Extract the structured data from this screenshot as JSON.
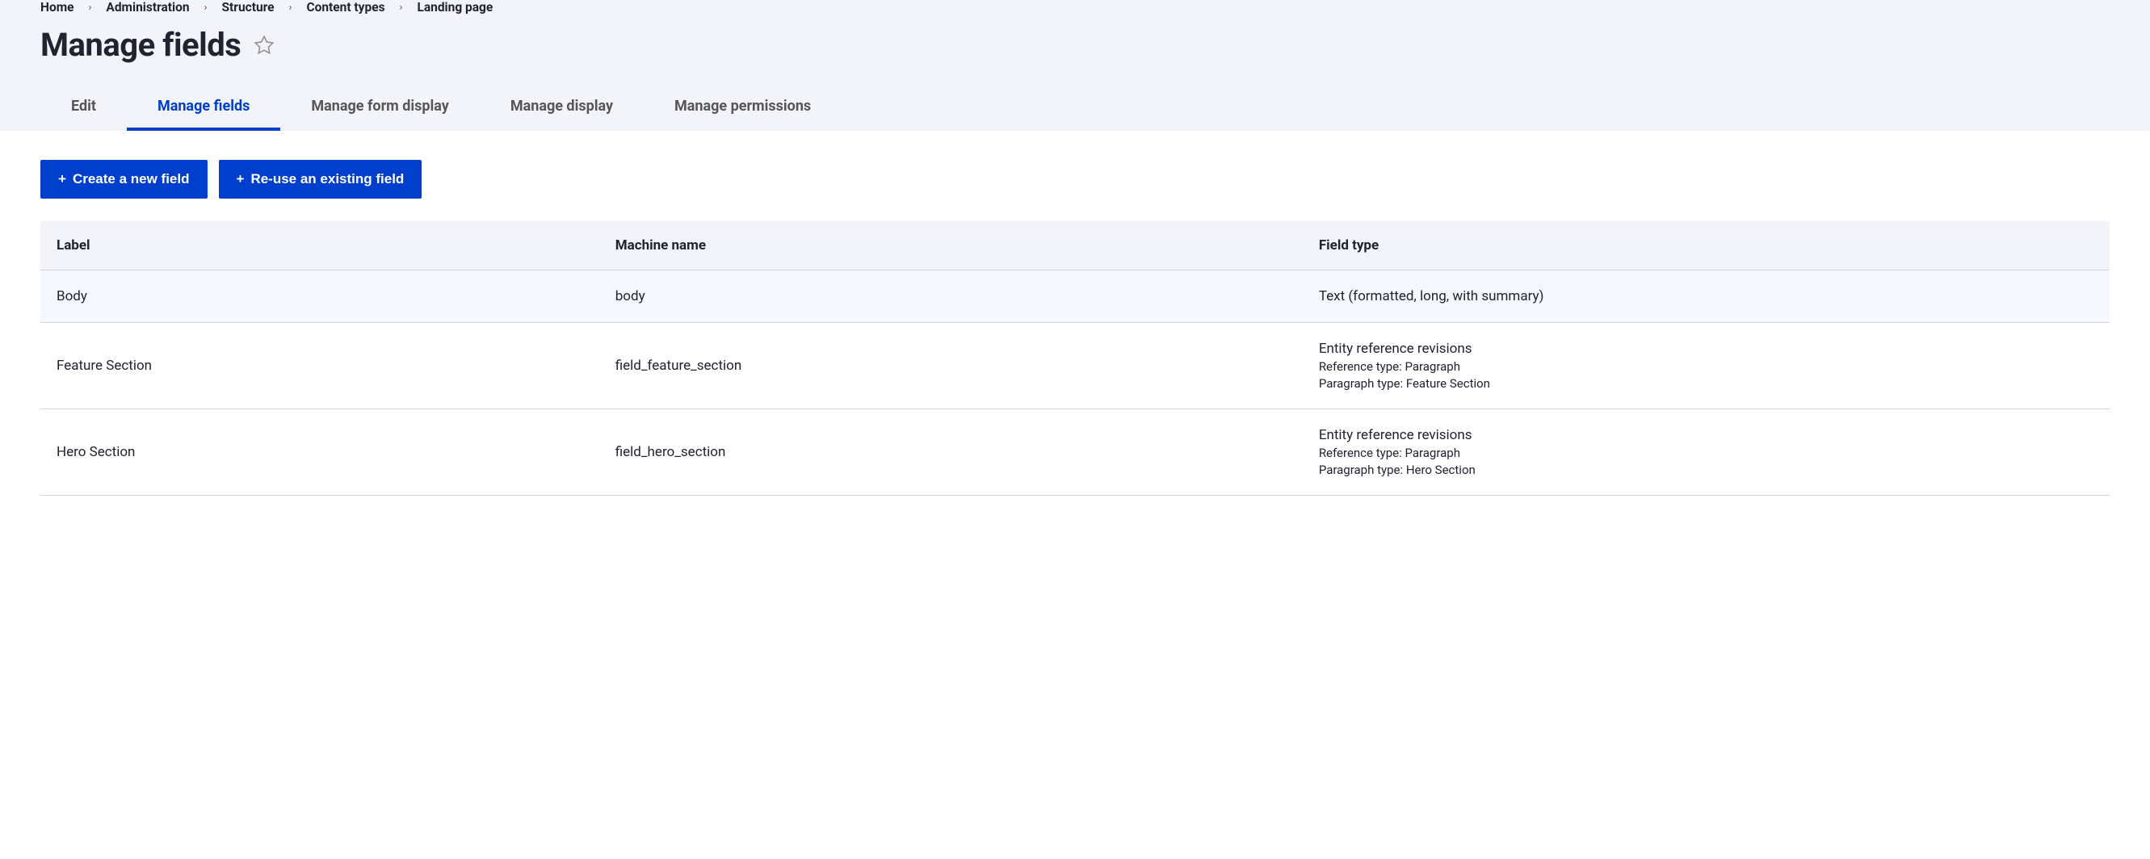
{
  "breadcrumb": [
    {
      "label": "Home"
    },
    {
      "label": "Administration"
    },
    {
      "label": "Structure"
    },
    {
      "label": "Content types"
    },
    {
      "label": "Landing page"
    }
  ],
  "page_title": "Manage fields",
  "tabs": [
    {
      "label": "Edit",
      "active": false
    },
    {
      "label": "Manage fields",
      "active": true
    },
    {
      "label": "Manage form display",
      "active": false
    },
    {
      "label": "Manage display",
      "active": false
    },
    {
      "label": "Manage permissions",
      "active": false
    }
  ],
  "actions": {
    "create": "Create a new field",
    "reuse": "Re-use an existing field"
  },
  "table": {
    "headers": {
      "label": "Label",
      "machine": "Machine name",
      "type": "Field type"
    },
    "rows": [
      {
        "label": "Body",
        "machine": "body",
        "type_main": "Text (formatted, long, with summary)",
        "type_sub1": "",
        "type_sub2": ""
      },
      {
        "label": "Feature Section",
        "machine": "field_feature_section",
        "type_main": "Entity reference revisions",
        "type_sub1": "Reference type: Paragraph",
        "type_sub2": "Paragraph type: Feature Section"
      },
      {
        "label": "Hero Section",
        "machine": "field_hero_section",
        "type_main": "Entity reference revisions",
        "type_sub1": "Reference type: Paragraph",
        "type_sub2": "Paragraph type: Hero Section"
      }
    ]
  }
}
